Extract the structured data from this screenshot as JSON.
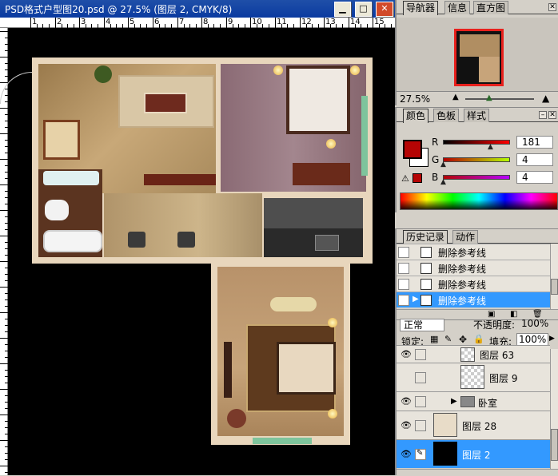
{
  "window": {
    "title": "PSD格式户型图20.psd @ 27.5% (图层 2, CMYK/8)",
    "minimize_glyph": "▁",
    "maximize_glyph": "□",
    "close_glyph": "✕"
  },
  "ruler": {
    "ticks": [
      "1",
      "2",
      "3",
      "4",
      "5",
      "6",
      "7",
      "8",
      "9",
      "10",
      "11",
      "12",
      "13",
      "14",
      "15"
    ]
  },
  "navigator": {
    "tabs": [
      "导航器",
      "信息",
      "直方图"
    ],
    "zoom": "27.5%"
  },
  "color_panel": {
    "tabs": [
      "颜色",
      "色板",
      "样式"
    ],
    "channels": [
      {
        "label": "R",
        "value": "181",
        "level": 0.71
      },
      {
        "label": "G",
        "value": "4",
        "level": 0.016
      },
      {
        "label": "B",
        "value": "4",
        "level": 0.016
      }
    ],
    "foreground_color": "#b50404",
    "background_color": "#ffffff",
    "warning_glyph": "⚠"
  },
  "history_panel": {
    "tabs": [
      "历史记录",
      "动作"
    ],
    "items": [
      {
        "label": "删除参考线",
        "active": false
      },
      {
        "label": "删除参考线",
        "active": false
      },
      {
        "label": "删除参考线",
        "active": false
      },
      {
        "label": "删除参考线",
        "active": true
      }
    ]
  },
  "layers_panel": {
    "blend_mode": "正常",
    "opacity_label": "不透明度:",
    "opacity_value": "100%",
    "lock_label": "锁定:",
    "fill_label": "填充:",
    "fill_value": "100%",
    "layers": [
      {
        "name": "图层 63",
        "visible": true,
        "type": "layer"
      },
      {
        "name": "图层 9",
        "visible": false,
        "type": "layer"
      },
      {
        "name": "卧室",
        "visible": true,
        "type": "group"
      },
      {
        "name": "图层 28",
        "visible": true,
        "type": "layer"
      },
      {
        "name": "图层 2",
        "visible": true,
        "type": "layer",
        "selected": true
      }
    ]
  },
  "colors": {
    "selection": "#3399ff",
    "titlebar": "#0a3aa0"
  }
}
